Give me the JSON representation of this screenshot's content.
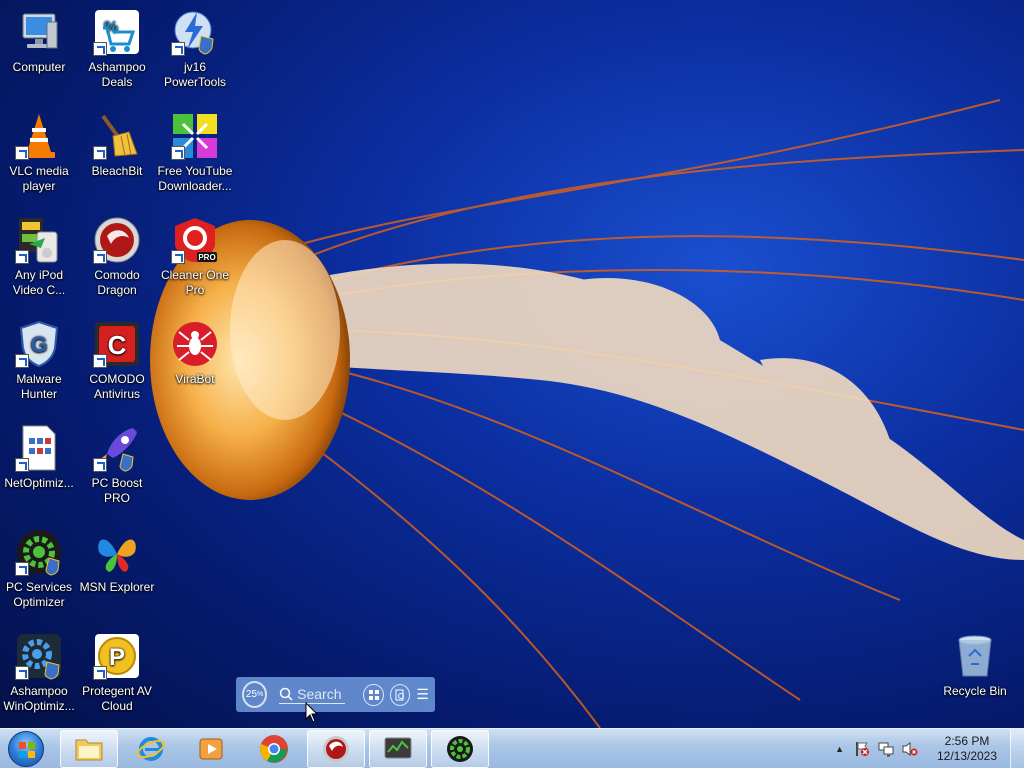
{
  "desktop": {
    "icons": [
      {
        "label": "Computer"
      },
      {
        "label": "Ashampoo Deals"
      },
      {
        "label": "jv16 PowerTools"
      },
      {
        "label": "VLC media player"
      },
      {
        "label": "BleachBit"
      },
      {
        "label": "Free YouTube Downloader..."
      },
      {
        "label": "Any iPod Video C..."
      },
      {
        "label": "Comodo Dragon"
      },
      {
        "label": "Cleaner One Pro"
      },
      {
        "label": "Malware Hunter"
      },
      {
        "label": "COMODO Antivirus"
      },
      {
        "label": "ViraBot"
      },
      {
        "label": "NetOptimiz..."
      },
      {
        "label": "PC Boost PRO"
      },
      {
        "label": "PC Services Optimizer"
      },
      {
        "label": "MSN Explorer"
      },
      {
        "label": "Ashampoo WinOptimiz..."
      },
      {
        "label": "Protegent  AV Cloud"
      },
      {
        "label": "Recycle Bin"
      }
    ]
  },
  "search_widget": {
    "percent": "25",
    "percent_sign": "%",
    "search_placeholder": "Search"
  },
  "taskbar": {
    "items": [
      {
        "icon": "windows-explorer-icon"
      },
      {
        "icon": "internet-explorer-icon"
      },
      {
        "icon": "media-player-icon"
      },
      {
        "icon": "chrome-icon"
      },
      {
        "icon": "comodo-dragon-icon"
      },
      {
        "icon": "system-monitor-icon"
      },
      {
        "icon": "pc-services-optimizer-icon"
      }
    ],
    "clock": {
      "time": "2:56 PM",
      "date": "12/13/2023"
    }
  },
  "colors": {
    "desktop_bg": "#0b2ea0",
    "taskbar_bg": "#a9c5e6",
    "jellyfish": "#f0a640"
  }
}
